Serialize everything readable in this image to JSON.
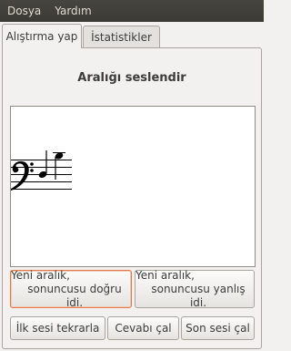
{
  "menubar": {
    "items": [
      "Dosya",
      "Yardım"
    ]
  },
  "tabs": {
    "active": "Alıştırma yap",
    "inactive": "İstatistikler"
  },
  "main": {
    "title": "Aralığı seslendir",
    "buttons": {
      "correct": {
        "line1": "Yeni aralık,",
        "line2": "sonuncusu doğru idi."
      },
      "wrong": {
        "line1": "Yeni aralık,",
        "line2": "sonuncusu yanlış idi."
      },
      "repeat_first": "İlk sesi tekrarla",
      "play_answer": "Cevabı çal",
      "play_last": "Son sesi çal"
    }
  },
  "notation": {
    "clef": "bass-clef-icon"
  },
  "colors": {
    "menubar": "#3b3a35",
    "focus": "#e07a4f"
  }
}
